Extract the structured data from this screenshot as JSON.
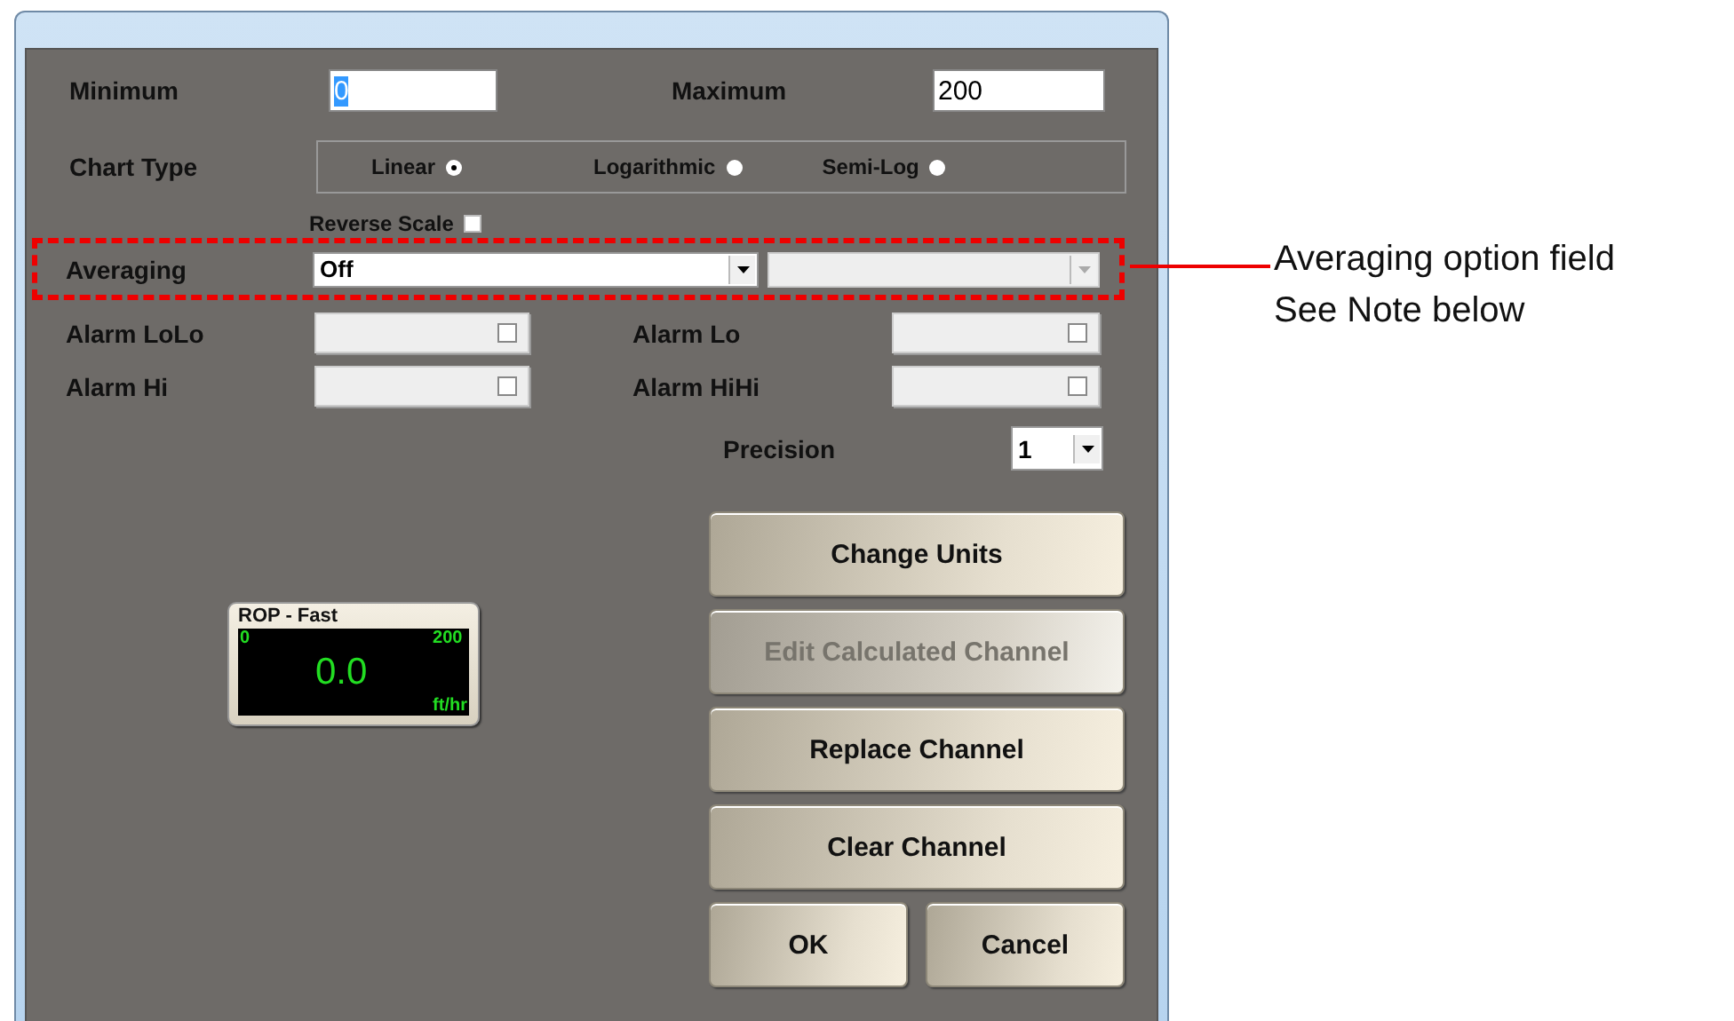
{
  "range": {
    "minimum": {
      "label": "Minimum",
      "value": "0",
      "value_highlighted": true
    },
    "maximum": {
      "label": "Maximum",
      "value": "200",
      "value_highlighted": false
    }
  },
  "chart_type": {
    "label": "Chart Type",
    "options": [
      {
        "label": "Linear",
        "selected": true
      },
      {
        "label": "Logarithmic",
        "selected": false
      },
      {
        "label": "Semi-Log",
        "selected": false
      }
    ]
  },
  "reverse_scale": {
    "label": "Reverse Scale",
    "checked": false
  },
  "averaging": {
    "label": "Averaging",
    "value": "Off",
    "secondary_disabled": true
  },
  "alarms": [
    {
      "label": "Alarm LoLo",
      "checked": false,
      "disabled": true
    },
    {
      "label": "Alarm Lo",
      "checked": false,
      "disabled": true
    },
    {
      "label": "Alarm Hi",
      "checked": false,
      "disabled": true
    },
    {
      "label": "Alarm HiHi",
      "checked": false,
      "disabled": true
    }
  ],
  "precision": {
    "label": "Precision",
    "value": "1"
  },
  "gauge": {
    "title": "ROP - Fast",
    "min": "0",
    "max": "200",
    "value": "0.0",
    "unit": "ft/hr"
  },
  "buttons": [
    {
      "label": "Change Units",
      "kind": "wide",
      "disabled": false
    },
    {
      "label": "Edit Calculated Channel",
      "kind": "wide",
      "disabled": true
    },
    {
      "label": "Replace Channel",
      "kind": "wide",
      "disabled": false
    },
    {
      "label": "Clear Channel",
      "kind": "wide",
      "disabled": false
    },
    {
      "label": "OK",
      "kind": "half",
      "disabled": false
    },
    {
      "label": "Cancel",
      "kind": "half",
      "disabled": false
    }
  ],
  "annotation": {
    "lines": [
      "Averaging option field",
      "See Note below"
    ]
  }
}
